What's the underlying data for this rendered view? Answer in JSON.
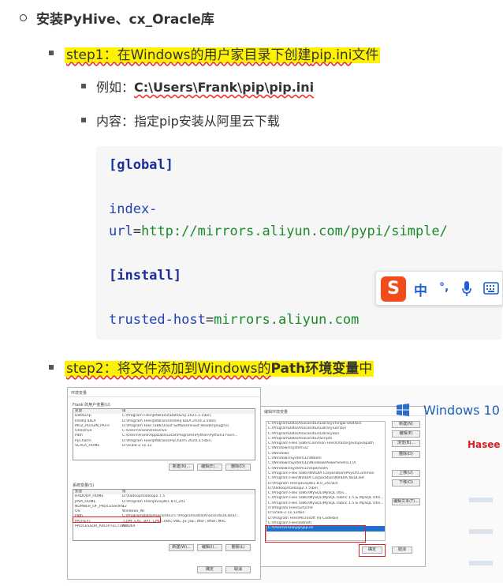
{
  "heading": "安装PyHive、cx_Oracle库",
  "step1": {
    "label": "step1：在Windows的用户家目录下创建",
    "file": "pip.ini",
    "suffix": "文件"
  },
  "example": {
    "prefix": "例如：",
    "path": "C:\\Users\\Frank\\pip\\pip.ini"
  },
  "content_line": "内容：指定pip安装从阿里云下载",
  "code": {
    "global": "[global]",
    "index_key_1": "index-",
    "index_key_2": "url",
    "eq": "=",
    "index_val": "http://mirrors.aliyun.com/pypi/simple/",
    "install": "[install]",
    "trusted_key": "trusted-host",
    "trusted_val": "mirrors.aliyun.com"
  },
  "ime": {
    "logo": "S",
    "zh": "中",
    "punct": "°,",
    "mic": "mic-icon",
    "kbd": "keyboard-icon"
  },
  "step2": {
    "prefix": "step2：将文件添加到Windows的",
    "bold": "Path环境变量",
    "suffix": "中"
  },
  "screenshot": {
    "env_title": "环境变量",
    "user_vars_label": "Frank 的用户变量(U)",
    "col_var": "变量",
    "col_val": "值",
    "user_vars": [
      [
        "DataGrip",
        "C:\\Program Files\\JetBrains\\DataGrip 2021.1.1\\bin;"
      ],
      [
        "IntelliJ IDEA",
        "D:\\Program Files\\JetBrains\\IntelliJ IDEA 2019.3.5\\bin;"
      ],
      [
        "MOZ_PLUGIN_PATH",
        "D:\\Program Files (x86)\\Foxit Software\\Foxit Reader\\plugins\\"
      ],
      [
        "OneDrive",
        "C:\\Users\\Frank\\OneDrive"
      ],
      [
        "Path",
        "C:\\Users\\Frank\\AppData\\Local\\Programs\\Python\\Python37\\Scri..."
      ],
      [
        "PyCharm",
        "D:\\Program Files\\JetBrains\\PyCharm 2020.3.5\\bin;"
      ],
      [
        "SCALA_HOME",
        "D:\\scala-2.11.12"
      ]
    ],
    "btn_new_u": "新建(N)...",
    "btn_edit_u": "编辑(E)...",
    "btn_del_u": "删除(D)",
    "sys_vars_label": "系统变量(S)",
    "sys_vars": [
      [
        "HADOOP_HOME",
        "D:\\hadoop\\hadoop2.7.5"
      ],
      [
        "JAVA_HOME",
        "D:\\Program Files\\Java\\jdk1.8.0_241"
      ],
      [
        "NUMBER_OF_PROCESSORS",
        "12"
      ],
      [
        "OS",
        "Windows_NT"
      ],
      [
        "Path",
        "C:\\ProgramData\\Anaconda3;C:\\ProgramData\\Anaconda3\\Librar..."
      ],
      [
        "PATHEXT",
        ".COM;.EXE;.BAT;.CMD;.VBS;.VBE;.JS;.JSE;.WSF;.WSH;.MSC"
      ],
      [
        "PROCESSOR_ARCHITECTURE",
        "AMD64"
      ]
    ],
    "btn_new_s": "新建(W)...",
    "btn_edit_s": "编辑(I)...",
    "btn_del_s": "删除(L)",
    "btn_ok": "确定",
    "btn_cancel": "取消",
    "edit_title": "编辑环境变量",
    "path_entries": [
      "C:\\ProgramData\\Anaconda3\\Library\\mingw-w64\\bin",
      "C:\\ProgramData\\Anaconda3\\Library\\usr\\bin",
      "C:\\ProgramData\\Anaconda3\\Library\\bin",
      "C:\\ProgramData\\Anaconda3\\Scripts",
      "C:\\Program Files (x86)\\Common Files\\Oracle\\Java\\javapath",
      "C:\\Windows\\system32",
      "C:\\Windows",
      "C:\\Windows\\System32\\Wbem",
      "C:\\Windows\\System32\\WindowsPowerShell\\v1.0\\",
      "C:\\Windows\\System32\\OpenSSH\\",
      "C:\\Program Files (x86)\\NVIDIA Corporation\\PhysX\\Common",
      "C:\\Program Files\\NVIDIA Corporation\\NVIDIA NvDLISR",
      "D:\\Program Files\\Java\\jdk1.8.0_241\\bin",
      "D:\\hadoop\\hadoop2.7.5\\bin",
      "C:\\Program Files (x86)\\MySQL\\MySQL Utili...",
      "C:\\Program Files (x86)\\MySQL\\MySQL Fabric 1.5 & MySQL Utili...",
      "C:\\Program Files (x86)\\MySQL\\MySQL Fabric 1.5 & MySQL Utili...",
      "d:\\Program Files\\Git\\cmd",
      "D:\\scala-2.11.12\\bin",
      "D:\\Program Files\\Microsoft VS Code\\bin",
      "C:\\Program Files\\dotnet\\",
      "C:\\Users\\Frank\\pip\\pip.ini"
    ],
    "edit_btns": [
      "新建(N)",
      "编辑(E)",
      "浏览(B)...",
      "删除(D)",
      "上移(U)",
      "下移(O)",
      "编辑文本(T)..."
    ],
    "edit_ok": "确定",
    "edit_cancel": "取消",
    "brand_win": "Windows 10",
    "brand_hasee": "Hasee"
  }
}
